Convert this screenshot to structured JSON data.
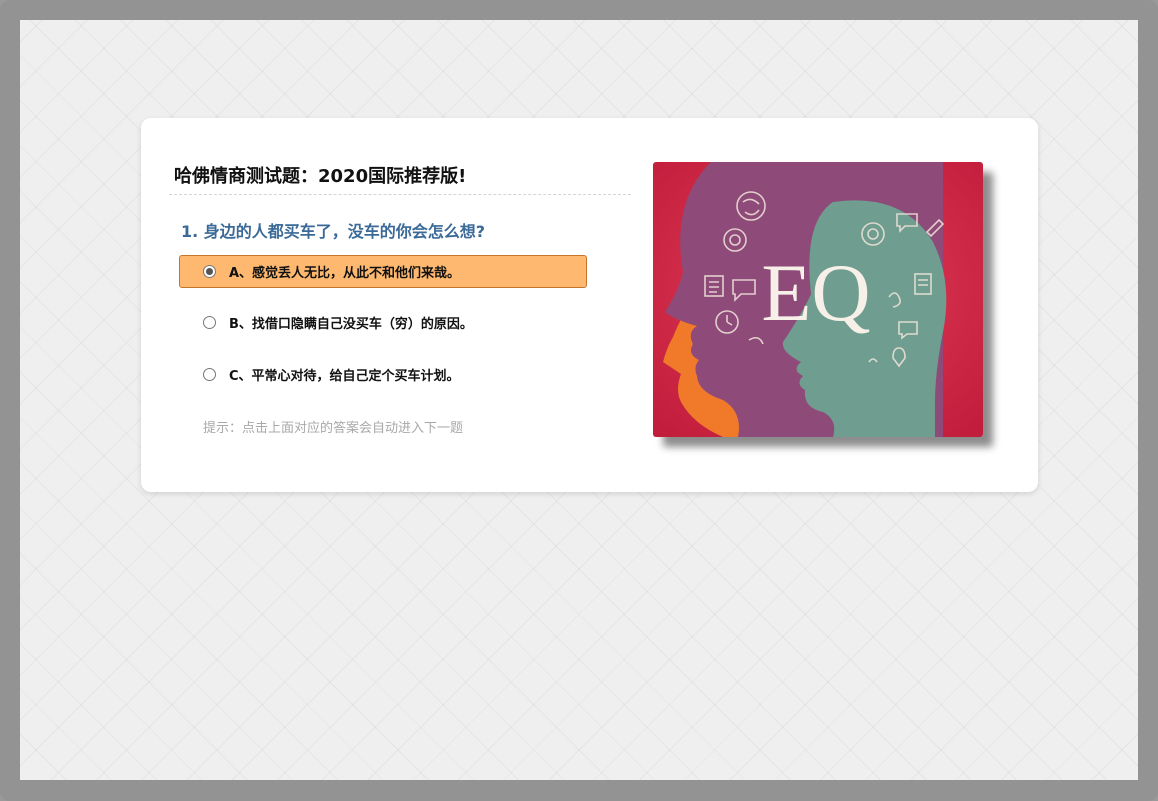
{
  "quiz": {
    "title": "哈佛情商测试题：2020国际推荐版!",
    "question": "1. 身边的人都买车了，没车的你会怎么想?",
    "options": [
      {
        "label": "A、感觉丢人无比，从此不和他们来哉。",
        "selected": true
      },
      {
        "label": "B、找借口隐瞒自己没买车（穷）的原因。",
        "selected": false
      },
      {
        "label": "C、平常心对待，给自己定个买车计划。",
        "selected": false
      }
    ],
    "hint": "提示：点击上面对应的答案会自动进入下一题"
  },
  "image": {
    "text": "EQ",
    "colors": {
      "background": "#d6324a",
      "left_head": "#8e4a78",
      "right_head": "#6f9d8f",
      "accent": "#f07a2a"
    }
  },
  "colors": {
    "selected_option": "#ffb870",
    "question_text": "#3b6a98"
  }
}
